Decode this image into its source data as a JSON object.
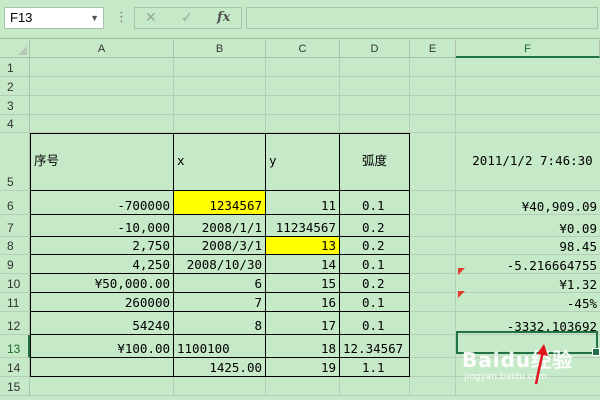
{
  "formula_bar": {
    "name_box": "F13",
    "separator": "⋮",
    "cancel_symbol": "✕",
    "enter_symbol": "✓",
    "fx_label": "fx",
    "formula_value": ""
  },
  "columns": [
    "A",
    "B",
    "C",
    "D",
    "E",
    "F"
  ],
  "selected_column": "F",
  "rows": [
    "1",
    "2",
    "3",
    "4",
    "5",
    "6",
    "7",
    "8",
    "9",
    "10",
    "11",
    "12",
    "13",
    "14",
    "15"
  ],
  "selected_row": "13",
  "cells": {
    "A5": "序号",
    "B5": "x",
    "C5": "y",
    "D5": "弧度",
    "F5": "2011/1/2 7:46:30",
    "A6": "-700000",
    "B6": "1234567",
    "C6": "11",
    "D6": "0.1",
    "F6": "¥40,909.09",
    "A7": "-10,000",
    "B7": "2008/1/1",
    "C7": "11234567",
    "D7": "0.2",
    "F7": "¥0.09",
    "A8": "2,750",
    "B8": "2008/3/1",
    "C8": "13",
    "D8": "0.2",
    "F8": "98.45",
    "A9": "4,250",
    "B9": "2008/10/30",
    "C9": "14",
    "D9": "0.1",
    "F9": "-5.216664755",
    "A10": "¥50,000.00",
    "B10": "6",
    "C10": "15",
    "D10": "0.2",
    "F10": "¥1.32",
    "A11": "260000",
    "B11": "7",
    "C11": "16",
    "D11": "0.1",
    "F11": "-45%",
    "A12": "54240",
    "B12": "8",
    "C12": "17",
    "D12": "0.1",
    "F12": "-3332.103692",
    "A13": "¥100.00",
    "B13": "1100100",
    "C13": "18",
    "D13": "12.34567",
    "F13": "",
    "B14": "1425.00",
    "C14": "19",
    "D14": "1.1"
  },
  "highlight_color": "#ffff00",
  "accent_color": "#217346",
  "watermark": {
    "text": "Baidu经验",
    "url": "jingyan.baidu.com"
  }
}
